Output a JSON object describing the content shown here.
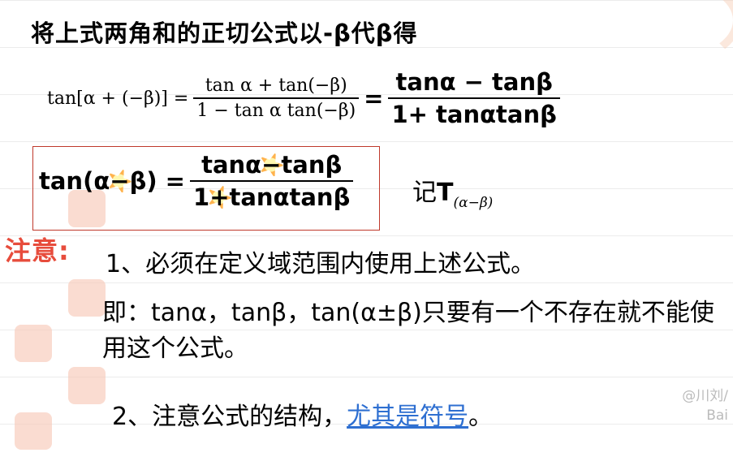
{
  "title": "将上式两角和的正切公式以-β代β得",
  "eq1": {
    "lhs": "tan[α + (−β)] =",
    "frac1_num": "tan α + tan(−β)",
    "frac1_den": "1 − tan α tan(−β)",
    "equals": "=",
    "frac2_num": "tanα − tanβ",
    "frac2_den": "1+ tanαtanβ"
  },
  "eq2": {
    "lhs_pre": "tan(α",
    "lhs_minus": "−",
    "lhs_post": "β) =",
    "num_pre": "tanα",
    "num_minus": "−",
    "num_post": "tanβ",
    "den_pre": "1",
    "den_plus": "+",
    "den_post": "tanαtanβ"
  },
  "record": {
    "label": "记",
    "symbol": "T",
    "sub": "(α−β)"
  },
  "note": {
    "label": "注意:",
    "item1": "1、必须在定义域范围内使用上述公式。",
    "item1_detail": "即：tanα，tanβ，tan(α±β)只要有一个不存在就不能使用这个公式。",
    "item2_prefix": "2、注意公式的结构，",
    "item2_highlight": "尤其是符号",
    "item2_suffix": "。"
  },
  "watermark": {
    "line1": "@川刘/",
    "line2": "Bai"
  },
  "colors": {
    "accent_red": "#e74c3c",
    "box_border": "#c0392b",
    "link_blue": "#2e6fd1"
  }
}
